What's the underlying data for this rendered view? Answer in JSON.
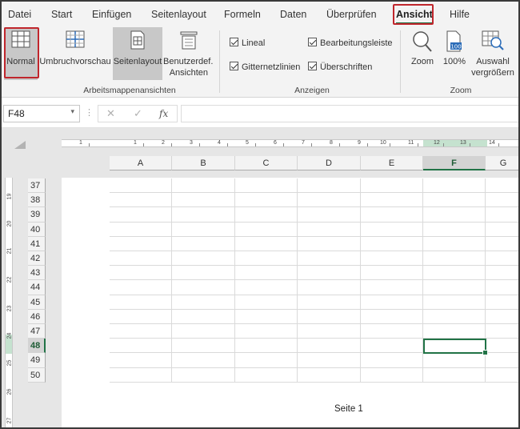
{
  "menu": {
    "items": [
      "Datei",
      "Start",
      "Einfügen",
      "Seitenlayout",
      "Formeln",
      "Daten",
      "Überprüfen",
      "Ansicht",
      "Hilfe"
    ],
    "active": "Ansicht"
  },
  "ribbon": {
    "workbook_views": {
      "group_label": "Arbeitsmappenansichten",
      "normal": "Normal",
      "page_break_preview": "Umbruchvorschau",
      "page_layout": "Seitenlayout",
      "custom_views_line1": "Benutzerdef.",
      "custom_views_line2": "Ansichten"
    },
    "show": {
      "group_label": "Anzeigen",
      "ruler": "Lineal",
      "gridlines": "Gitternetzlinien",
      "formula_bar": "Bearbeitungsleiste",
      "headings": "Überschriften"
    },
    "zoom": {
      "group_label": "Zoom",
      "zoom": "Zoom",
      "hundred": "100%",
      "selection_line1": "Auswahl",
      "selection_line2": "vergrößern",
      "hundred_icon_text": "100"
    }
  },
  "formula_bar": {
    "name_box": "F48",
    "dropdown": "▾",
    "fx": "fx",
    "cancel": "✕",
    "enter": "✓",
    "value": ""
  },
  "sheet": {
    "columns": [
      "A",
      "B",
      "C",
      "D",
      "E",
      "F",
      "G"
    ],
    "selected_column": "F",
    "rows": [
      "37",
      "38",
      "39",
      "40",
      "41",
      "42",
      "43",
      "44",
      "45",
      "46",
      "47",
      "48",
      "49",
      "50"
    ],
    "selected_row": "48",
    "active_cell": "F48",
    "page_label": "Seite 1",
    "ruler_h_numbers": [
      "1",
      "1",
      "2",
      "3",
      "4",
      "5",
      "6",
      "7",
      "8",
      "9",
      "10",
      "11",
      "12",
      "13",
      "14",
      "1"
    ],
    "ruler_v_numbers": [
      "19",
      "20",
      "21",
      "22",
      "23",
      "24",
      "25",
      "26",
      "27"
    ]
  },
  "colors": {
    "accent": "#217346",
    "highlight_box": "#c0262c",
    "ruler_highlight": "#c5e2cf"
  }
}
